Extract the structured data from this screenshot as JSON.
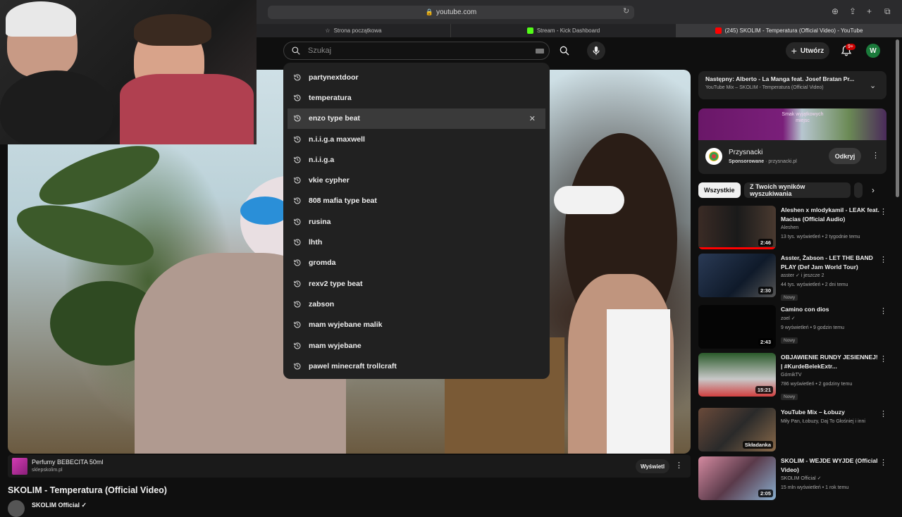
{
  "browser": {
    "url": "youtube.com",
    "tabs": [
      {
        "label": "Strona początkowa",
        "active": false
      },
      {
        "label": "Stream - Kick Dashboard",
        "active": false
      },
      {
        "label": "(245) SKOLIM - Temperatura (Official Video) - YouTube",
        "active": true
      }
    ]
  },
  "header": {
    "search_placeholder": "Szukaj",
    "create_label": "Utwórz",
    "notification_count": "9+",
    "avatar_letter": "W"
  },
  "suggestions": [
    "partynextdoor",
    "temperatura",
    "enzo type beat",
    "n.i.i.g.a maxwell",
    "n.i.i.g.a",
    "vkie cypher",
    "808 mafia type beat",
    "rusina",
    "lhth",
    "gromda",
    "rexv2 type beat",
    "zabson",
    "mam wyjebane malik",
    "mam wyjebane",
    "pawel minecraft trollcraft"
  ],
  "hovered_suggestion_index": 2,
  "up_next": {
    "title": "Następny: Alberto - La Manga feat. Josef Bratan Pr...",
    "subtitle": "YouTube Mix – SKOLIM - Temperatura (Official Video)"
  },
  "sidebar_ad": {
    "banner_text": "Smak wyjątkowych miejsc",
    "name": "Przysnacki",
    "sponsored": "Sponsorowane",
    "domain": " · przysnacki.pl",
    "open_label": "Odkryj"
  },
  "chips": [
    "Wszystkie",
    "Z Twoich wyników wyszukiwania"
  ],
  "recommendations": [
    {
      "title": "Aleshen x mlodykamil - LEAK feat. Macias (Official Audio)",
      "channel": "Aleshen",
      "meta": "13 tys. wyświetleń • 2 tygodnie temu",
      "duration": "2:46",
      "badge": "",
      "progress": 1.0
    },
    {
      "title": "Asster, Żabson - LET THE BAND PLAY (Def Jam World Tour)",
      "channel": "asster ✓ i jeszcze 2",
      "meta": "44 tys. wyświetleń • 2 dni temu",
      "duration": "2:30",
      "badge": "Nowy",
      "progress": 0
    },
    {
      "title": "Camino con dios",
      "channel": "zoel ✓",
      "meta": "9 wyświetleń • 9 godzin temu",
      "duration": "2:43",
      "badge": "Nowy",
      "progress": 0
    },
    {
      "title": "OBJAWIENIE RUNDY JESIENNEJ! | #KurdeBelekExtr...",
      "channel": "GórnikTV",
      "meta": "786 wyświetleń • 2 godziny temu",
      "duration": "15:21",
      "badge": "Nowy",
      "progress": 0
    },
    {
      "title": "YouTube Mix – Łobuzy",
      "channel": "Miły Pan, Łobuzy, Daj To Głośniej i inni",
      "meta": "",
      "duration": "Składanka",
      "badge": "",
      "progress": 0
    },
    {
      "title": "SKOLIM - WEJDE WYJDE (Official Video)",
      "channel": "SKOLIM Official ✓",
      "meta": "15 mln wyświetleń • 1 rok temu",
      "duration": "2:05",
      "badge": "",
      "progress": 0
    }
  ],
  "video_ad": {
    "title": "Perfumy BEBECITA 50ml",
    "url": "sklepskolim.pl",
    "button": "Wyświetl"
  },
  "video": {
    "title": "SKOLIM - Temperatura (Official Video)",
    "channel": "SKOLIM Official ✓"
  }
}
